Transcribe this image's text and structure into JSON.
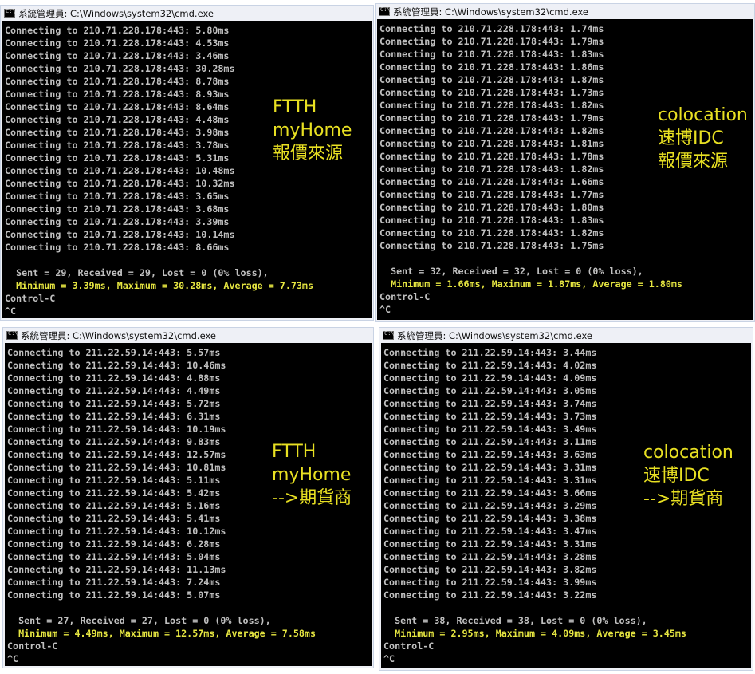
{
  "windows": [
    {
      "id": "tl",
      "title": "系統管理員: C:\\Windows\\system32\\cmd.exe",
      "lines": [
        "Connecting to 210.71.228.178:443: 5.80ms",
        "Connecting to 210.71.228.178:443: 4.53ms",
        "Connecting to 210.71.228.178:443: 3.46ms",
        "Connecting to 210.71.228.178:443: 30.28ms",
        "Connecting to 210.71.228.178:443: 8.78ms",
        "Connecting to 210.71.228.178:443: 8.93ms",
        "Connecting to 210.71.228.178:443: 8.64ms",
        "Connecting to 210.71.228.178:443: 4.48ms",
        "Connecting to 210.71.228.178:443: 3.98ms",
        "Connecting to 210.71.228.178:443: 3.78ms",
        "Connecting to 210.71.228.178:443: 5.31ms",
        "Connecting to 210.71.228.178:443: 10.48ms",
        "Connecting to 210.71.228.178:443: 10.32ms",
        "Connecting to 210.71.228.178:443: 3.65ms",
        "Connecting to 210.71.228.178:443: 3.68ms",
        "Connecting to 210.71.228.178:443: 3.39ms",
        "Connecting to 210.71.228.178:443: 10.14ms",
        "Connecting to 210.71.228.178:443: 8.66ms",
        "",
        "  Sent = 29, Received = 29, Lost = 0 (0% loss),",
        "  Minimum = 3.39ms, Maximum = 30.28ms, Average = 7.73ms",
        "Control-C",
        "^C"
      ],
      "label": "FTTH\nmyHome\n報價來源"
    },
    {
      "id": "tr",
      "title": "系統管理員: C:\\Windows\\system32\\cmd.exe",
      "lines": [
        "Connecting to 210.71.228.178:443: 1.74ms",
        "Connecting to 210.71.228.178:443: 1.79ms",
        "Connecting to 210.71.228.178:443: 1.83ms",
        "Connecting to 210.71.228.178:443: 1.86ms",
        "Connecting to 210.71.228.178:443: 1.87ms",
        "Connecting to 210.71.228.178:443: 1.73ms",
        "Connecting to 210.71.228.178:443: 1.82ms",
        "Connecting to 210.71.228.178:443: 1.79ms",
        "Connecting to 210.71.228.178:443: 1.82ms",
        "Connecting to 210.71.228.178:443: 1.81ms",
        "Connecting to 210.71.228.178:443: 1.78ms",
        "Connecting to 210.71.228.178:443: 1.82ms",
        "Connecting to 210.71.228.178:443: 1.66ms",
        "Connecting to 210.71.228.178:443: 1.77ms",
        "Connecting to 210.71.228.178:443: 1.80ms",
        "Connecting to 210.71.228.178:443: 1.83ms",
        "Connecting to 210.71.228.178:443: 1.82ms",
        "Connecting to 210.71.228.178:443: 1.75ms",
        "",
        "  Sent = 32, Received = 32, Lost = 0 (0% loss),",
        "  Minimum = 1.66ms, Maximum = 1.87ms, Average = 1.80ms",
        "Control-C",
        "^C"
      ],
      "label": "colocation\n速博IDC\n報價來源"
    },
    {
      "id": "bl",
      "title": "系統管理員: C:\\Windows\\system32\\cmd.exe",
      "lines": [
        "Connecting to 211.22.59.14:443: 5.57ms",
        "Connecting to 211.22.59.14:443: 10.46ms",
        "Connecting to 211.22.59.14:443: 4.88ms",
        "Connecting to 211.22.59.14:443: 4.49ms",
        "Connecting to 211.22.59.14:443: 5.72ms",
        "Connecting to 211.22.59.14:443: 6.31ms",
        "Connecting to 211.22.59.14:443: 10.19ms",
        "Connecting to 211.22.59.14:443: 9.83ms",
        "Connecting to 211.22.59.14:443: 12.57ms",
        "Connecting to 211.22.59.14:443: 10.81ms",
        "Connecting to 211.22.59.14:443: 5.11ms",
        "Connecting to 211.22.59.14:443: 5.42ms",
        "Connecting to 211.22.59.14:443: 5.16ms",
        "Connecting to 211.22.59.14:443: 5.41ms",
        "Connecting to 211.22.59.14:443: 10.12ms",
        "Connecting to 211.22.59.14:443: 6.28ms",
        "Connecting to 211.22.59.14:443: 5.04ms",
        "Connecting to 211.22.59.14:443: 11.13ms",
        "Connecting to 211.22.59.14:443: 7.24ms",
        "Connecting to 211.22.59.14:443: 5.07ms",
        "",
        "  Sent = 27, Received = 27, Lost = 0 (0% loss),",
        "  Minimum = 4.49ms, Maximum = 12.57ms, Average = 7.58ms",
        "Control-C",
        "^C"
      ],
      "label": "FTTH\nmyHome\n-->期貨商"
    },
    {
      "id": "br",
      "title": "系統管理員: C:\\Windows\\system32\\cmd.exe",
      "lines": [
        "Connecting to 211.22.59.14:443: 3.44ms",
        "Connecting to 211.22.59.14:443: 4.02ms",
        "Connecting to 211.22.59.14:443: 4.09ms",
        "Connecting to 211.22.59.14:443: 3.05ms",
        "Connecting to 211.22.59.14:443: 3.74ms",
        "Connecting to 211.22.59.14:443: 3.73ms",
        "Connecting to 211.22.59.14:443: 3.49ms",
        "Connecting to 211.22.59.14:443: 3.11ms",
        "Connecting to 211.22.59.14:443: 3.63ms",
        "Connecting to 211.22.59.14:443: 3.31ms",
        "Connecting to 211.22.59.14:443: 3.31ms",
        "Connecting to 211.22.59.14:443: 3.66ms",
        "Connecting to 211.22.59.14:443: 3.29ms",
        "Connecting to 211.22.59.14:443: 3.38ms",
        "Connecting to 211.22.59.14:443: 3.47ms",
        "Connecting to 211.22.59.14:443: 3.31ms",
        "Connecting to 211.22.59.14:443: 3.28ms",
        "Connecting to 211.22.59.14:443: 3.82ms",
        "Connecting to 211.22.59.14:443: 3.99ms",
        "Connecting to 211.22.59.14:443: 3.22ms",
        "",
        "  Sent = 38, Received = 38, Lost = 0 (0% loss),",
        "  Minimum = 2.95ms, Maximum = 4.09ms, Average = 3.45ms",
        "Control-C",
        "^C"
      ],
      "label": "colocation\n速博IDC\n-->期貨商"
    }
  ],
  "colors": {
    "console_bg": "#000000",
    "console_text": "#c0c0c0",
    "summary_text": "#e6e641",
    "label_text": "#e8e022",
    "titlebar_bg": "#eef0f6"
  }
}
